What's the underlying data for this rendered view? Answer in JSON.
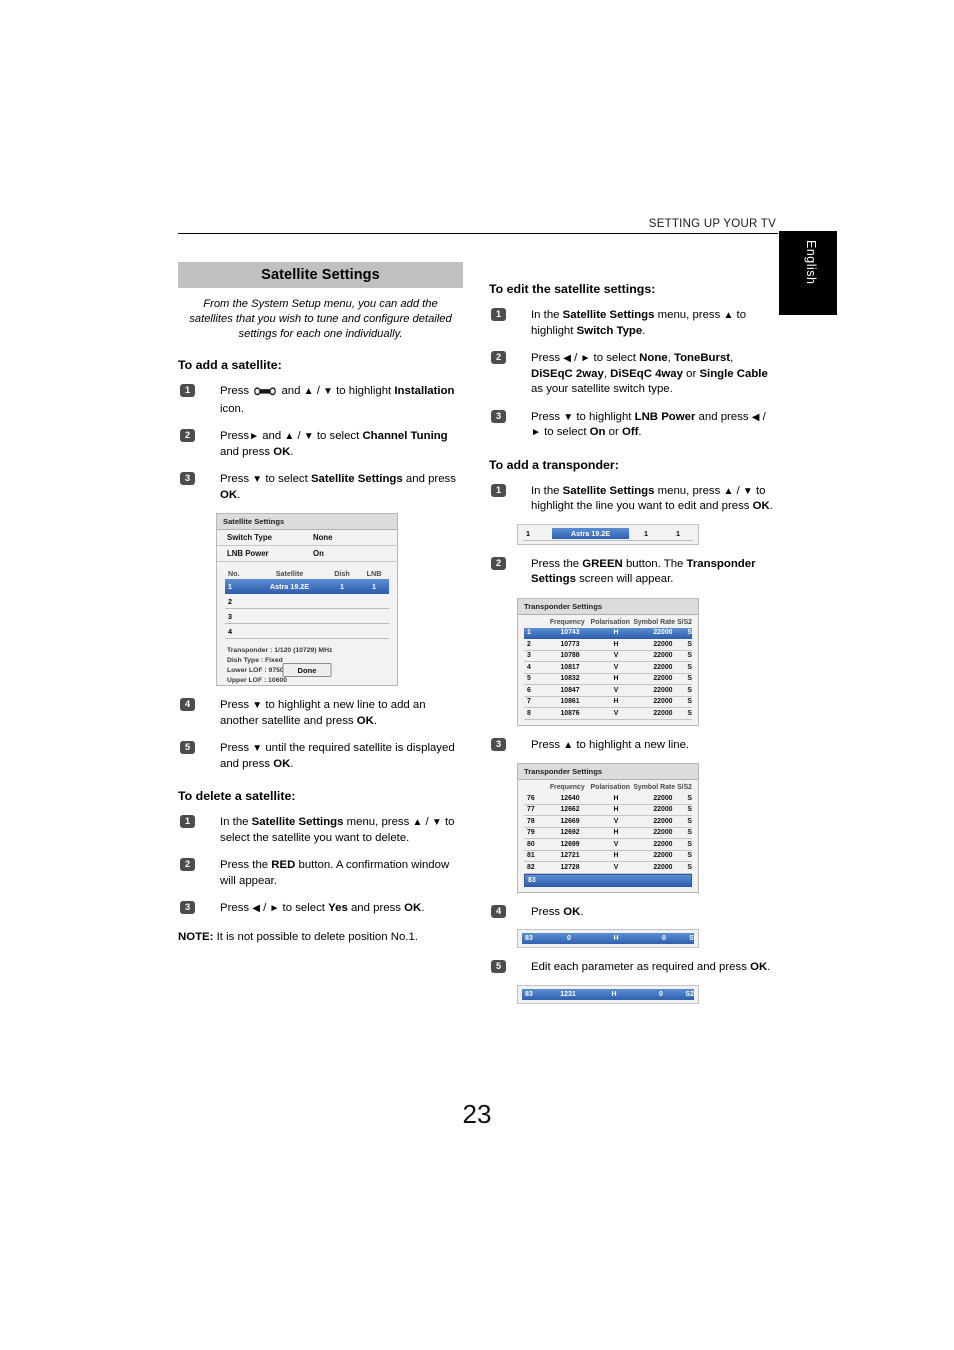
{
  "header": {
    "running_title": "SETTING UP YOUR TV",
    "language_tab": "English"
  },
  "page_number": "23",
  "left_column": {
    "banner_title": "Satellite Settings",
    "intro": "From the System Setup menu, you can add the satellites that you wish to tune and configure detailed settings for each one individually.",
    "add_heading": "To add a satellite:",
    "steps_add": [
      {
        "num": "1",
        "html": "Press <span class=\"wrench\" data-name=\"wrench-icon\"><svg width=\"22\" height=\"9\" viewBox=\"0 0 22 9\"><path d=\"M3.3 0.4 C1.3 0.4 0.2 2 0.2 4.3 C0.2 6.6 1.4 8.3 3.4 8.3 C4.6 8.3 5.4 7.6 5.9 6.6 L16.1 6.6 C16.6 7.6 17.4 8.3 18.6 8.3 C20.6 8.3 21.8 6.6 21.8 4.3 C21.8 2 20.7 0.4 18.7 0.4 C17.5 0.4 16.6 1.1 16.1 2.1 L5.9 2.1 C5.4 1.1 4.5 0.4 3.3 0.4 Z M3.3 1.9 C4.5 1.9 5.3 2.9 5.3 4.3 C5.3 5.8 4.5 6.8 3.3 6.8 C2.1 6.8 1.4 5.8 1.4 4.3 C1.4 2.9 2.1 1.9 3.3 1.9 Z M18.7 1.9 C19.9 1.9 20.6 2.9 20.6 4.3 C20.6 5.8 19.9 6.8 18.7 6.8 C17.5 6.8 16.7 5.8 16.7 4.3 C16.7 2.9 17.5 1.9 18.7 1.9 Z\" fill=\"#1a1a1a\"/></svg></span> and <span class=\"arrow\">&#9650;</span> / <span class=\"arrow\">&#9660;</span> to highlight <b>Installation</b> icon."
      },
      {
        "num": "2",
        "html": "Press<span class=\"arrow\">&#9658;</span> and <span class=\"arrow\">&#9650;</span> / <span class=\"arrow\">&#9660;</span> to select <b>Channel Tuning</b> and press <b>OK</b>."
      },
      {
        "num": "3",
        "html": "Press <span class=\"arrow\">&#9660;</span> to select <b>Satellite Settings</b> and press <b>OK</b>."
      }
    ],
    "steps_add_after": [
      {
        "num": "4",
        "html": "Press <span class=\"arrow\">&#9660;</span> to highlight a new line to add an another satellite and press <b>OK</b>."
      },
      {
        "num": "5",
        "html": "Press <span class=\"arrow\">&#9660;</span> until the required satellite is displayed and press <b>OK</b>."
      }
    ],
    "delete_heading": "To delete a satellite:",
    "steps_delete": [
      {
        "num": "1",
        "html": "In the <b>Satellite Settings</b> menu, press <span class=\"arrow\">&#9650;</span> / <span class=\"arrow\">&#9660;</span> to select the satellite you want to delete."
      },
      {
        "num": "2",
        "html": "Press the <b>RED</b> button. A confirmation window will appear."
      },
      {
        "num": "3",
        "html": "Press <span class=\"arrow\">&#9664;</span> / <span class=\"arrow\">&#9658;</span> to select <b>Yes</b> and press <b>OK</b>."
      }
    ],
    "note": "<b>NOTE:</b> It is not possible to delete position No.1.",
    "satellite_panel": {
      "title": "Satellite Settings",
      "switch_type_label": "Switch Type",
      "switch_type_value": "None",
      "lnb_power_label": "LNB Power",
      "lnb_power_value": "On",
      "columns": [
        "No.",
        "Satellite",
        "Dish",
        "LNB"
      ],
      "rows": [
        {
          "no": "1",
          "satellite": "Astra 19.2E",
          "dish": "1",
          "lnb": "1",
          "selected": true
        },
        {
          "no": "2",
          "satellite": "",
          "dish": "",
          "lnb": "",
          "selected": false
        },
        {
          "no": "3",
          "satellite": "",
          "dish": "",
          "lnb": "",
          "selected": false
        },
        {
          "no": "4",
          "satellite": "",
          "dish": "",
          "lnb": "",
          "selected": false
        }
      ],
      "info": [
        "Transponder : 1/120 (10729) MHz",
        "Dish Type : Fixed",
        "Lower LOF : 9750",
        "Upper LOF : 10600"
      ],
      "done_label": "Done"
    }
  },
  "right_column": {
    "edit_heading": "To edit the satellite settings:",
    "steps_edit": [
      {
        "num": "1",
        "html": "In the <b>Satellite Settings</b> menu, press <span class=\"arrow\">&#9650;</span> to highlight <b>Switch Type</b>."
      },
      {
        "num": "2",
        "html": "Press <span class=\"arrow\">&#9664;</span> / <span class=\"arrow\">&#9658;</span> to select <b>None</b>, <b>ToneBurst</b>, <b>DiSEqC 2way</b>, <b>DiSEqC 4way</b> or <b>Single Cable</b> as your satellite switch type."
      },
      {
        "num": "3",
        "html": "Press <span class=\"arrow\">&#9660;</span> to highlight <b>LNB Power</b> and press <span class=\"arrow\">&#9664;</span> / <span class=\"arrow\">&#9658;</span> to select <b>On</b> or <b>Off</b>."
      }
    ],
    "transponder_heading": "To add a transponder:",
    "step_tp1": {
      "num": "1",
      "html": "In the <b>Satellite Settings</b> menu, press <span class=\"arrow\">&#9650;</span> / <span class=\"arrow\">&#9660;</span> to highlight the line you want to edit and press <b>OK</b>."
    },
    "satellite_strip": {
      "no": "1",
      "satellite": "Astra 19.2E",
      "dish": "1",
      "lnb": "1"
    },
    "step_tp2": {
      "num": "2",
      "html": "Press the <b>GREEN</b> button. The <b>Transponder Settings</b> screen will appear."
    },
    "transponder_panel_1": {
      "title": "Transponder Settings",
      "columns": [
        "",
        "Frequency",
        "Polarisation",
        "Symbol Rate",
        "S/S2"
      ],
      "rows": [
        {
          "idx": "1",
          "frequency": "10743",
          "polarisation": "H",
          "symbol_rate": "22000",
          "s_s2": "S",
          "selected": true
        },
        {
          "idx": "2",
          "frequency": "10773",
          "polarisation": "H",
          "symbol_rate": "22000",
          "s_s2": "S",
          "selected": false
        },
        {
          "idx": "3",
          "frequency": "10788",
          "polarisation": "V",
          "symbol_rate": "22000",
          "s_s2": "S",
          "selected": false
        },
        {
          "idx": "4",
          "frequency": "10817",
          "polarisation": "V",
          "symbol_rate": "22000",
          "s_s2": "S",
          "selected": false
        },
        {
          "idx": "5",
          "frequency": "10832",
          "polarisation": "H",
          "symbol_rate": "22000",
          "s_s2": "S",
          "selected": false
        },
        {
          "idx": "6",
          "frequency": "10847",
          "polarisation": "V",
          "symbol_rate": "22000",
          "s_s2": "S",
          "selected": false
        },
        {
          "idx": "7",
          "frequency": "10861",
          "polarisation": "H",
          "symbol_rate": "22000",
          "s_s2": "S",
          "selected": false
        },
        {
          "idx": "8",
          "frequency": "10876",
          "polarisation": "V",
          "symbol_rate": "22000",
          "s_s2": "S",
          "selected": false
        }
      ]
    },
    "step_tp3": {
      "num": "3",
      "html": "Press <span class=\"arrow\">&#9650;</span> to highlight a new line."
    },
    "transponder_panel_2": {
      "title": "Transponder Settings",
      "columns": [
        "",
        "Frequency",
        "Polarisation",
        "Symbol Rate",
        "S/S2"
      ],
      "rows": [
        {
          "idx": "76",
          "frequency": "12640",
          "polarisation": "H",
          "symbol_rate": "22000",
          "s_s2": "S",
          "selected": false
        },
        {
          "idx": "77",
          "frequency": "12662",
          "polarisation": "H",
          "symbol_rate": "22000",
          "s_s2": "S",
          "selected": false
        },
        {
          "idx": "78",
          "frequency": "12669",
          "polarisation": "V",
          "symbol_rate": "22000",
          "s_s2": "S",
          "selected": false
        },
        {
          "idx": "79",
          "frequency": "12692",
          "polarisation": "H",
          "symbol_rate": "22000",
          "s_s2": "S",
          "selected": false
        },
        {
          "idx": "80",
          "frequency": "12699",
          "polarisation": "V",
          "symbol_rate": "22000",
          "s_s2": "S",
          "selected": false
        },
        {
          "idx": "81",
          "frequency": "12721",
          "polarisation": "H",
          "symbol_rate": "22000",
          "s_s2": "S",
          "selected": false
        },
        {
          "idx": "82",
          "frequency": "12728",
          "polarisation": "V",
          "symbol_rate": "22000",
          "s_s2": "S",
          "selected": false
        },
        {
          "idx": "83",
          "frequency": "",
          "polarisation": "",
          "symbol_rate": "",
          "s_s2": "",
          "selected": true,
          "empty": true
        }
      ]
    },
    "step_tp4": {
      "num": "4",
      "html": "Press <b>OK</b>."
    },
    "edit_bar_1": {
      "idx": "83",
      "frequency": "0",
      "polarisation": "H",
      "symbol_rate": "0",
      "s_s2": "S"
    },
    "step_tp5": {
      "num": "5",
      "html": "Edit each parameter as required and press <b>OK</b>."
    },
    "edit_bar_2": {
      "idx": "83",
      "frequency": "1231",
      "polarisation": "H",
      "symbol_rate": "0",
      "s_s2": "S2"
    }
  }
}
